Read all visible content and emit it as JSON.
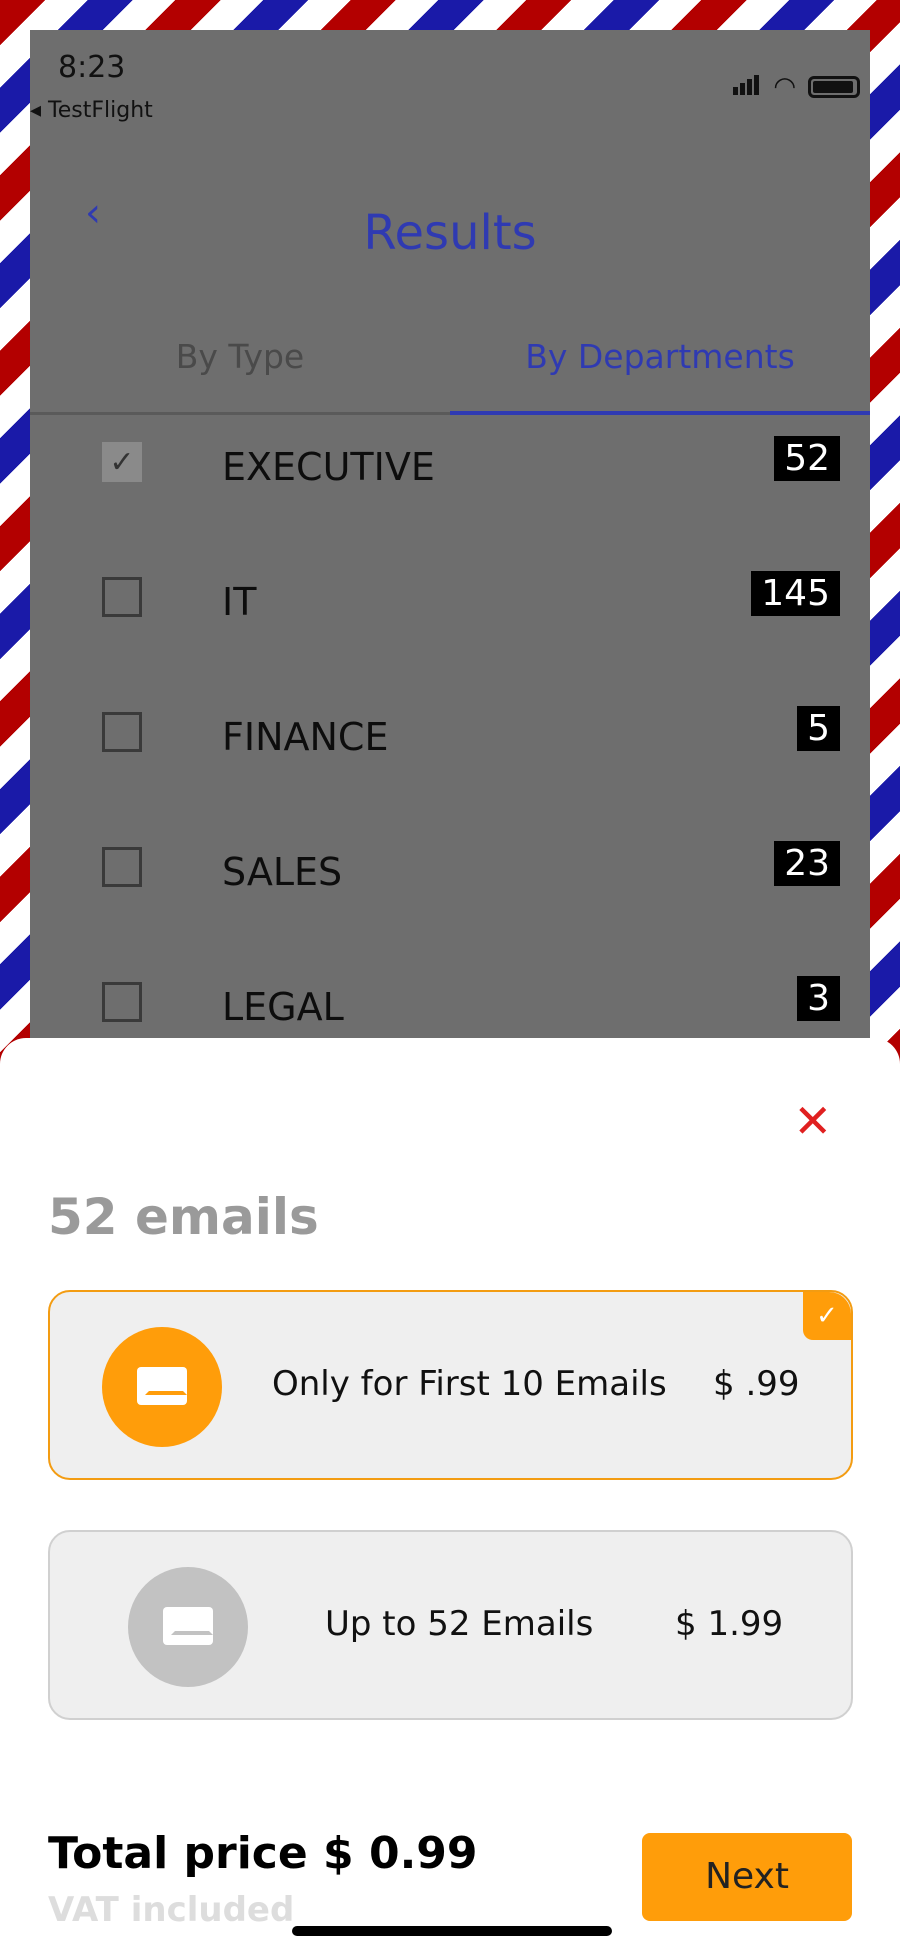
{
  "status": {
    "time": "8:23",
    "back_app": "◂ TestFlight"
  },
  "nav": {
    "back_icon": "‹",
    "title": "Results"
  },
  "tabs": [
    {
      "label": "By Type",
      "active": false
    },
    {
      "label": "By Departments",
      "active": true
    }
  ],
  "departments": [
    {
      "name": "EXECUTIVE",
      "count": "52",
      "checked": true
    },
    {
      "name": "IT",
      "count": "145",
      "checked": false
    },
    {
      "name": "FINANCE",
      "count": "5",
      "checked": false
    },
    {
      "name": "SALES",
      "count": "23",
      "checked": false
    },
    {
      "name": "LEGAL",
      "count": "3",
      "checked": false
    }
  ],
  "sheet": {
    "close_icon": "✕",
    "heading": "52 emails",
    "options": [
      {
        "label": "Only for First 10 Emails",
        "price": "$ .99",
        "selected": true,
        "check_icon": "✓"
      },
      {
        "label": "Up to 52 Emails",
        "price": "$ 1.99",
        "selected": false
      }
    ],
    "total": "Total price $ 0.99",
    "vat": "VAT included",
    "next_label": "Next"
  },
  "colors": {
    "accent": "#ff9d0a",
    "nav_blue": "#2f3ab2",
    "close_red": "#e02020"
  }
}
